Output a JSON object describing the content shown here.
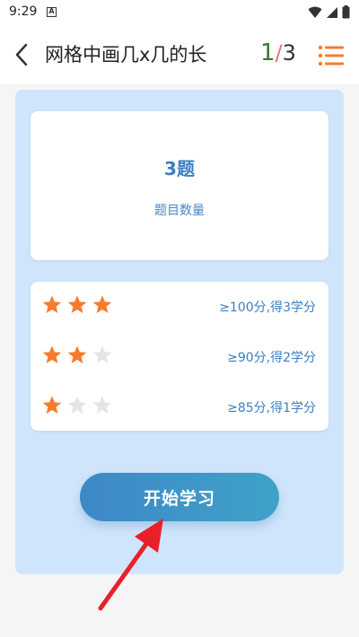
{
  "status_bar": {
    "time": "9:29",
    "notification_icon_letter": "A",
    "icons": [
      "wifi-icon",
      "signal-icon",
      "battery-icon"
    ]
  },
  "header": {
    "title": "网格中画几x几的长",
    "counter_current": "1",
    "counter_separator": "/",
    "counter_total": "3"
  },
  "summary": {
    "question_count": "3题",
    "question_label": "题目数量"
  },
  "rules": [
    {
      "stars_filled": 3,
      "stars_total": 3,
      "text": "≥100分,得3学分"
    },
    {
      "stars_filled": 2,
      "stars_total": 3,
      "text": "≥90分,得2学分"
    },
    {
      "stars_filled": 1,
      "stars_total": 3,
      "text": "≥85分,得1学分"
    }
  ],
  "actions": {
    "start_label": "开始学习"
  },
  "colors": {
    "accent_blue": "#3b7fc2",
    "star_filled": "#f57c2f",
    "star_empty": "#e5e5e5",
    "counter_current": "#2e7d32",
    "menu_icon": "#f57c2f",
    "arrow": "#e8202a"
  }
}
